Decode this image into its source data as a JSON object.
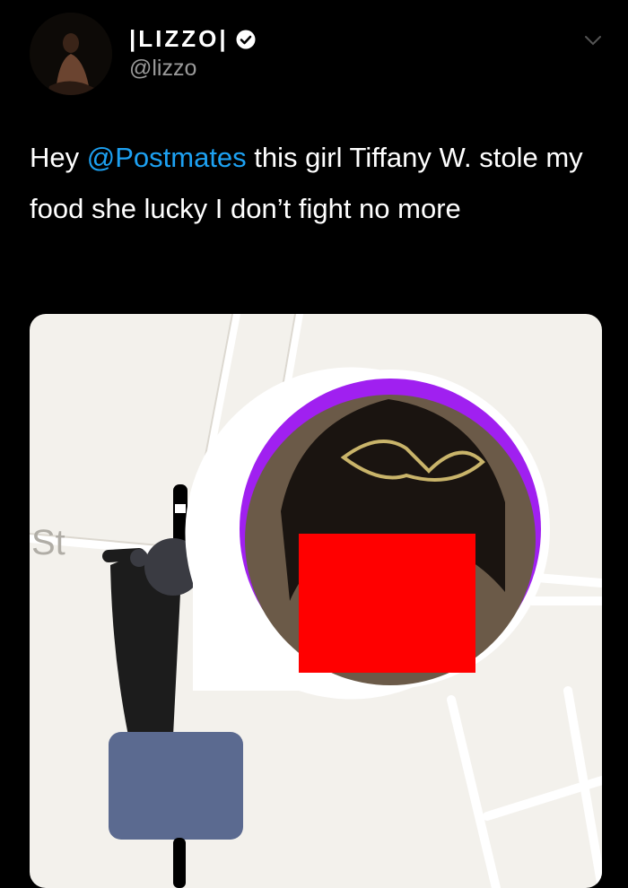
{
  "author": {
    "display_name": "|LIZZO|",
    "handle": "@lizzo",
    "verified": true,
    "avatar_icon": "profile-photo",
    "menu_icon": "chevron-down-icon"
  },
  "tweet": {
    "text_before": "Hey ",
    "mention": "@Postmates",
    "text_after": " this girl Tiffany W. stole my food she lucky I don’t fight no more"
  },
  "media": {
    "map_street_label": "St",
    "colors": {
      "map_bg": "#f3f1ec",
      "courier_pin_ring": "#ffffff",
      "ring_accent": "#a020f0",
      "redaction": "#ff0000"
    }
  }
}
